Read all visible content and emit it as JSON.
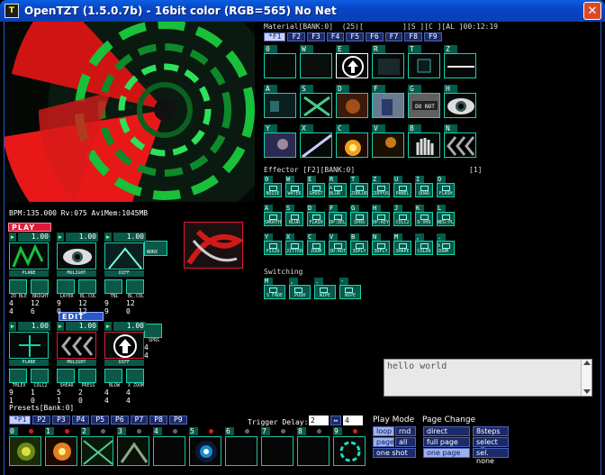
{
  "window": {
    "title": "OpenTZT (1.5.0.7b) - 16bit color (RGB=565) No Net",
    "close_glyph": "✕",
    "icon_text": "T"
  },
  "status": {
    "bpm_line": "BPM:135.000 Rv:075 AviMem:1045MB"
  },
  "material": {
    "header": "Material[BANK:0]  (25)[         ][S ][C ][AL ]00:12:19",
    "tabs": [
      "*F1",
      "F2",
      "F3",
      "F4",
      "F5",
      "F6",
      "F7",
      "F8",
      "F9"
    ],
    "rows": [
      [
        "0",
        "W",
        "E",
        "R",
        "T",
        "Z"
      ],
      [
        "A",
        "S",
        "D",
        "F",
        "G",
        "H"
      ],
      [
        "Y",
        "X",
        "C",
        "V",
        "B",
        "N"
      ]
    ]
  },
  "effector": {
    "header": "Effector [F2][BANK:0]",
    "count": "[1]",
    "keys": [
      [
        "0",
        "W",
        "E",
        "R",
        "T",
        "Z",
        "U",
        "I",
        "O",
        "P"
      ],
      [
        "A",
        "S",
        "D",
        "F",
        "G",
        "H",
        "J",
        "K",
        "L",
        "Ö"
      ],
      [
        "Y",
        "X",
        "C",
        "V",
        "B",
        "N",
        "M",
        ",",
        ".",
        "-"
      ]
    ],
    "labels": [
      [
        "NOISE",
        "WATER",
        "GHOST",
        "A BLUR",
        "ZOBLUR",
        "ZOPPUS",
        "PANEL",
        "QUAD",
        "FLASH",
        ""
      ],
      [
        "SMOOTH",
        "BLUR",
        "FLASH",
        "DP:DEL",
        "SPRS",
        "DP:KEY",
        "COLC2",
        "D:VHS",
        "NEG:PL",
        ""
      ],
      [
        "PIX2D",
        "JITTER",
        "ZOOM",
        "3D:ROT",
        "3DPLY",
        "3DFLY",
        "SHAPE",
        "COLOR",
        "X ZOOM",
        ""
      ]
    ]
  },
  "switching": {
    "header": "Switching",
    "items": [
      {
        "key": "M",
        "label": "S FADE"
      },
      {
        "key": ",",
        "label": "PUSH"
      },
      {
        "key": ".",
        "label": "WIPE"
      },
      {
        "key": "-",
        "label": "WIPE"
      }
    ]
  },
  "play": {
    "badge": "PLAY",
    "channels": [
      {
        "level": "1.00",
        "label": "PLANE"
      },
      {
        "level": "1.00",
        "label": "MULIGHT"
      },
      {
        "level": "1.00",
        "label": "DIFF"
      }
    ],
    "side_label": "NORX",
    "subs": [
      {
        "label": "ZO BLE",
        "v1": "4",
        "v2": "4"
      },
      {
        "label": "BRIGHT",
        "v1": "12",
        "v2": "6"
      },
      {
        "label": "LAYER",
        "v1": "9",
        "v2": "0"
      },
      {
        "label": "BL.COL",
        "v1": "12",
        "v2": "12"
      },
      {
        "label": "TNL",
        "v1": "9",
        "v2": "9"
      },
      {
        "label": "BL.COL",
        "v1": "12",
        "v2": "0"
      }
    ]
  },
  "edit": {
    "badge": "EDIT",
    "channels": [
      {
        "level": "1.00",
        "label": "PLANE"
      },
      {
        "level": "1.00",
        "label": "MULIGHT"
      },
      {
        "level": "1.00",
        "label": "DIFF"
      }
    ],
    "side": {
      "label": "SPRS",
      "v1": "4",
      "v2": "4"
    },
    "subs": [
      {
        "label": "TMLEX",
        "v1": "9",
        "v2": "1"
      },
      {
        "label": "COLC2",
        "v1": "1",
        "v2": "0"
      },
      {
        "label": "SHEAR",
        "v1": "5",
        "v2": "1"
      },
      {
        "label": "PRESS",
        "v1": "2",
        "v2": "0"
      },
      {
        "label": "BLOW",
        "v1": "4",
        "v2": "4"
      },
      {
        "label": "X ZOOM",
        "v1": "4",
        "v2": "4"
      }
    ]
  },
  "presets": {
    "header": "Presets[Bank:0]",
    "tabs": [
      "*P1",
      "P2",
      "P3",
      "P4",
      "P5",
      "P6",
      "P7",
      "P8",
      "P9"
    ],
    "cues": [
      {
        "key": "0",
        "dot": "red"
      },
      {
        "key": "1",
        "dot": "red"
      },
      {
        "key": "2",
        "dot": "gray"
      },
      {
        "key": "3",
        "dot": "gray"
      },
      {
        "key": "4",
        "dot": "gray"
      },
      {
        "key": "5",
        "dot": "red"
      },
      {
        "key": "6",
        "dot": "gray"
      },
      {
        "key": "7",
        "dot": "gray"
      },
      {
        "key": "8",
        "dot": "gray"
      },
      {
        "key": "9",
        "dot": "red"
      }
    ]
  },
  "trigger": {
    "label": "Trigger Delay:",
    "value": "2",
    "swap": "↔",
    "value2": "4"
  },
  "playmode": {
    "header": "Play Mode",
    "loop": "loop",
    "rnd": "rnd",
    "page": "page",
    "all": "all",
    "oneshot": "one shot"
  },
  "pagechange": {
    "header": "Page Change",
    "direct": "direct",
    "steps": "8steps",
    "full": "full page",
    "selectall": "select all",
    "onepage": "one page",
    "selnone": "sel. none"
  },
  "textbox": {
    "value": "hello world"
  },
  "colors": {
    "accent": "#14d4b0",
    "badge_red": "#e01a3a",
    "badge_blue": "#2a56c8"
  }
}
